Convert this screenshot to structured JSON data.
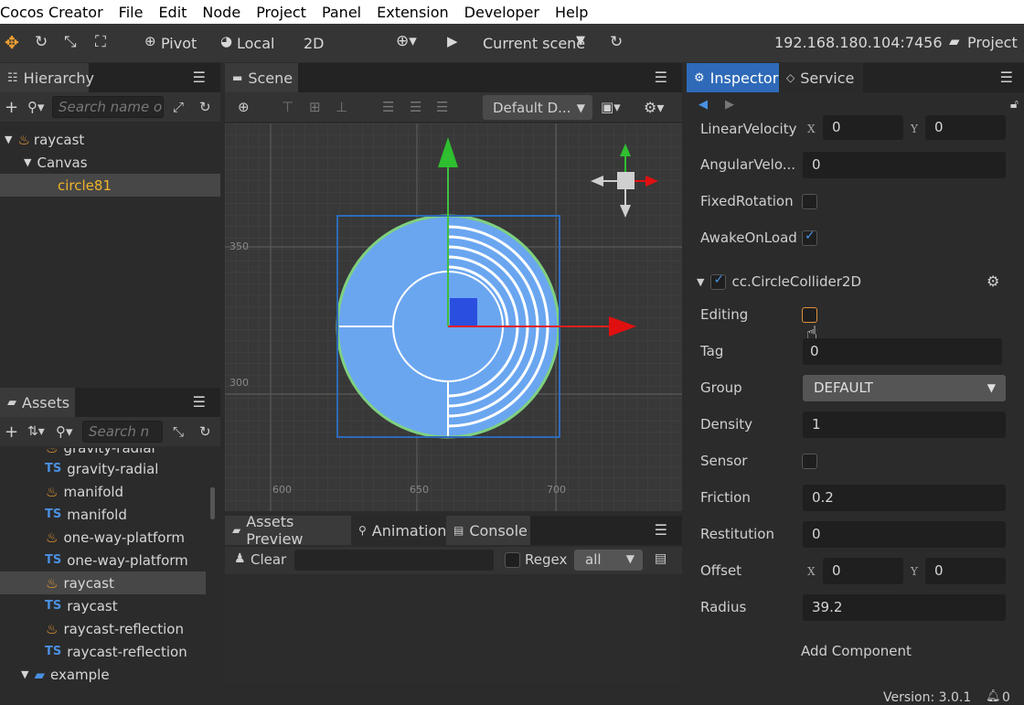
{
  "menubar": [
    "Cocos Creator",
    "File",
    "Edit",
    "Node",
    "Project",
    "Panel",
    "Extension",
    "Developer",
    "Help"
  ],
  "toolbar": {
    "pivot": "Pivot",
    "local": "Local",
    "mode2d": "2D",
    "scene_select": "Current scene",
    "ip": "192.168.180.104:7456",
    "project": "Project"
  },
  "hierarchy": {
    "title": "Hierarchy",
    "search_placeholder": "Search name o",
    "nodes": [
      {
        "label": "raycast"
      },
      {
        "label": "Canvas"
      },
      {
        "label": "circle81"
      }
    ]
  },
  "scene": {
    "title": "Scene",
    "camera_select": "Default D...",
    "axis_y": [
      "350",
      "300"
    ],
    "axis_x": [
      "600",
      "650",
      "700"
    ]
  },
  "assets": {
    "title": "Assets",
    "search_placeholder": "Search n",
    "items": [
      {
        "type": "fire",
        "label": "gravity-radial",
        "partial": true
      },
      {
        "type": "TS",
        "label": "gravity-radial"
      },
      {
        "type": "fire",
        "label": "manifold"
      },
      {
        "type": "TS",
        "label": "manifold"
      },
      {
        "type": "fire",
        "label": "one-way-platform"
      },
      {
        "type": "TS",
        "label": "one-way-platform"
      },
      {
        "type": "fire",
        "label": "raycast"
      },
      {
        "type": "TS",
        "label": "raycast"
      },
      {
        "type": "fire",
        "label": "raycast-reflection"
      },
      {
        "type": "TS",
        "label": "raycast-reflection"
      },
      {
        "type": "folder",
        "label": "example"
      }
    ]
  },
  "console": {
    "tabs": [
      "Assets Preview",
      "Animation",
      "Console"
    ],
    "clear": "Clear",
    "regex": "Regex",
    "filter": "all"
  },
  "inspector": {
    "tabs": [
      "Inspector",
      "Service"
    ],
    "linear_velocity": {
      "label": "LinearVelocity",
      "x": "0",
      "y": "0"
    },
    "angular_velocity": {
      "label": "AngularVelo...",
      "value": "0"
    },
    "fixed_rotation": {
      "label": "FixedRotation"
    },
    "awake_on_load": {
      "label": "AwakeOnLoad"
    },
    "component": "cc.CircleCollider2D",
    "editing": {
      "label": "Editing"
    },
    "tag": {
      "label": "Tag",
      "value": "0"
    },
    "group": {
      "label": "Group",
      "value": "DEFAULT"
    },
    "density": {
      "label": "Density",
      "value": "1"
    },
    "sensor": {
      "label": "Sensor"
    },
    "friction": {
      "label": "Friction",
      "value": "0.2"
    },
    "restitution": {
      "label": "Restitution",
      "value": "0"
    },
    "offset": {
      "label": "Offset",
      "x": "0",
      "y": "0"
    },
    "radius": {
      "label": "Radius",
      "value": "39.2"
    },
    "add_component": "Add Component",
    "x_label": "X",
    "y_label": "Y"
  },
  "status": {
    "version": "Version: 3.0.1",
    "notifications": "0"
  },
  "colors": {
    "accent": "#2e6ab8",
    "selected_text": "#f0b429",
    "circle": "#6aa6f0"
  }
}
